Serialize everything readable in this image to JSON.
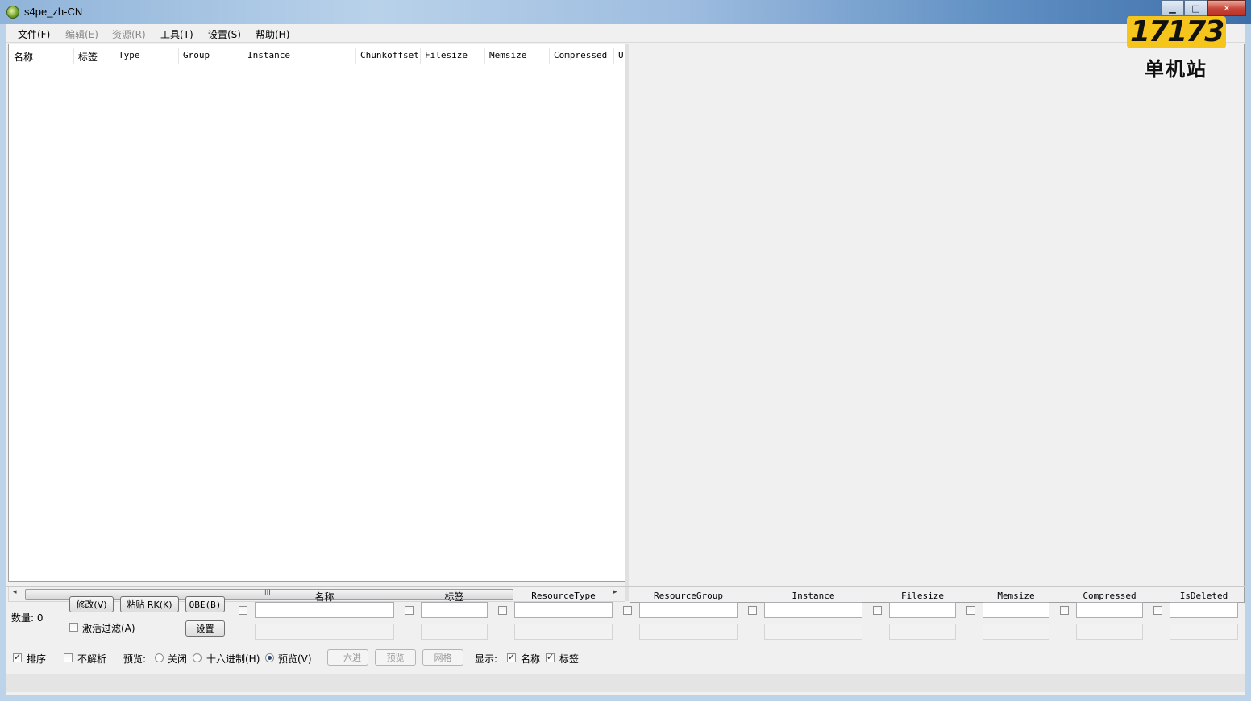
{
  "window": {
    "title": "s4pe_zh-CN",
    "minimize": "▁",
    "maximize": "□",
    "close": "✕"
  },
  "logo": {
    "number": "17173",
    "subtitle": "单机站"
  },
  "menu": [
    {
      "label": "文件(F)",
      "enabled": true
    },
    {
      "label": "编辑(E)",
      "enabled": false
    },
    {
      "label": "资源(R)",
      "enabled": false
    },
    {
      "label": "工具(T)",
      "enabled": true
    },
    {
      "label": "设置(S)",
      "enabled": true
    },
    {
      "label": "帮助(H)",
      "enabled": true
    }
  ],
  "list": {
    "columns": [
      "名称",
      "标签",
      "Type",
      "Group",
      "Instance",
      "Chunkoffset",
      "Filesize",
      "Memsize",
      "Compressed",
      "U"
    ],
    "scroll_grip": "III",
    "scroll_left": "◂",
    "scroll_right": "▸"
  },
  "filter": {
    "count_label": "数量: 0",
    "modify_button": "修改(V)",
    "paste_rk_button": "粘贴 RK(K)",
    "qbe_button": "QBE(B)",
    "settings_button": "设置",
    "activate_filter_label": "激活过滤(A)",
    "activate_filter_checked": false,
    "fields": [
      {
        "title": "名称"
      },
      {
        "title": "标签"
      },
      {
        "title": "ResourceType"
      },
      {
        "title": "ResourceGroup"
      },
      {
        "title": "Instance"
      },
      {
        "title": "Filesize"
      },
      {
        "title": "Memsize"
      },
      {
        "title": "Compressed"
      },
      {
        "title": "IsDeleted"
      }
    ]
  },
  "options": {
    "sort_label": "排序",
    "sort_checked": true,
    "no_parse_label": "不解析",
    "no_parse_checked": false,
    "preview_label": "预览:",
    "radio_off": "关闭",
    "radio_hex": "十六进制(H)",
    "radio_preview": "预览(V)",
    "selected_radio": "preview",
    "hex_button": "十六进",
    "preview_button": "预览",
    "grid_button": "网格",
    "display_label": "显示:",
    "show_name_label": "名称",
    "show_name_checked": true,
    "show_tag_label": "标签",
    "show_tag_checked": true
  }
}
